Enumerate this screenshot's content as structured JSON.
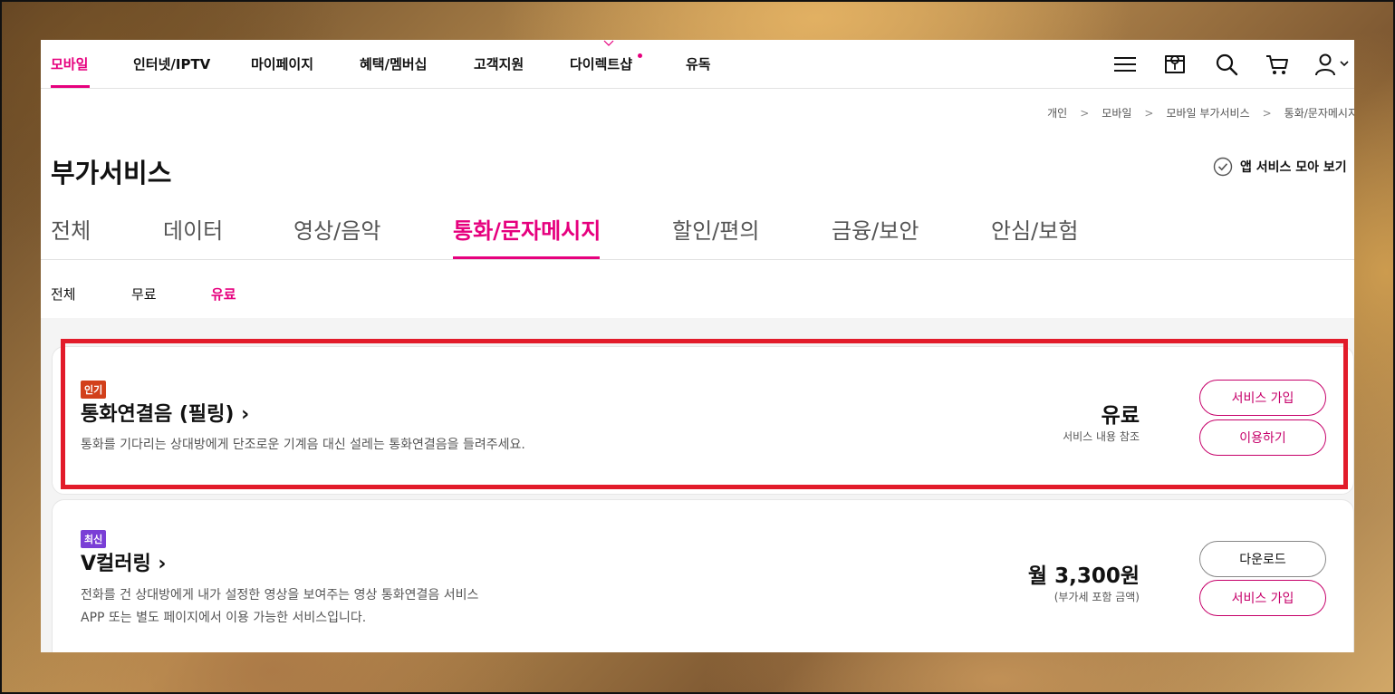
{
  "gnb": {
    "items": [
      {
        "label": "모바일",
        "active": true
      },
      {
        "label": "인터넷/IPTV"
      },
      {
        "label": "마이페이지"
      },
      {
        "label": "혜택/멤버십"
      },
      {
        "label": "고객지원"
      },
      {
        "label": "다이렉트샵",
        "has_dot": true
      },
      {
        "label": "유독"
      }
    ],
    "icons": [
      "menu-icon",
      "store-icon",
      "search-icon",
      "cart-icon",
      "user-icon"
    ]
  },
  "breadcrumb": [
    "개인",
    "모바일",
    "모바일 부가서비스",
    "통화/문자메시지"
  ],
  "page": {
    "title": "부가서비스",
    "app_link": "앱 서비스 모아 보기"
  },
  "category_tabs": [
    {
      "label": "전체"
    },
    {
      "label": "데이터"
    },
    {
      "label": "영상/음악"
    },
    {
      "label": "통화/문자메시지",
      "active": true
    },
    {
      "label": "할인/편의"
    },
    {
      "label": "금융/보안"
    },
    {
      "label": "안심/보험"
    }
  ],
  "sub_tabs": [
    {
      "label": "전체"
    },
    {
      "label": "무료"
    },
    {
      "label": "유료",
      "active": true
    }
  ],
  "services": [
    {
      "badge": "인기",
      "badge_color": "#d2401b",
      "title": "통화연결음 (필링) ›",
      "description": [
        "통화를 기다리는 상대방에게 단조로운 기계음 대신 설레는 통화연결음을 들려주세요."
      ],
      "price": "유료",
      "price_note": "서비스 내용 참조",
      "buttons": [
        {
          "label": "서비스 가입",
          "style": "pink"
        },
        {
          "label": "이용하기",
          "style": "pink"
        }
      ]
    },
    {
      "badge": "최신",
      "badge_color": "#7a3fd6",
      "title": "V컬러링 ›",
      "description": [
        "전화를 건 상대방에게 내가 설정한 영상을 보여주는 영상 통화연결음 서비스",
        "APP 또는 별도 페이지에서 이용 가능한 서비스입니다."
      ],
      "price": "월 3,300원",
      "price_note": "(부가세 포함 금액)",
      "buttons": [
        {
          "label": "다운로드",
          "style": "gray"
        },
        {
          "label": "서비스 가입",
          "style": "pink"
        }
      ]
    }
  ],
  "colors": {
    "accent": "#e6007e",
    "highlight": "#e21b2a"
  }
}
